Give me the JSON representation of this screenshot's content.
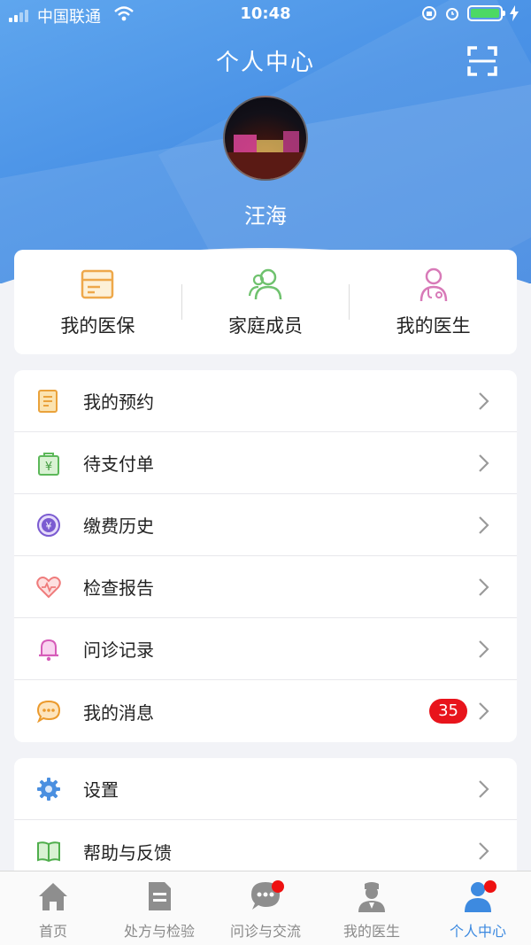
{
  "status_bar": {
    "carrier": "中国联通",
    "time": "10:48"
  },
  "header": {
    "title": "个人中心",
    "user_name": "汪海"
  },
  "quick_actions": [
    {
      "label": "我的医保",
      "icon": "card-icon"
    },
    {
      "label": "家庭成员",
      "icon": "family-icon"
    },
    {
      "label": "我的医生",
      "icon": "doctor-icon"
    }
  ],
  "menu_primary": [
    {
      "label": "我的预约",
      "icon": "appointment-icon"
    },
    {
      "label": "待支付单",
      "icon": "payment-bag-icon"
    },
    {
      "label": "缴费历史",
      "icon": "yuan-coin-icon"
    },
    {
      "label": "检查报告",
      "icon": "heart-report-icon"
    },
    {
      "label": "问诊记录",
      "icon": "bell-icon"
    },
    {
      "label": "我的消息",
      "icon": "message-icon",
      "badge": "35"
    }
  ],
  "menu_secondary": [
    {
      "label": "设置",
      "icon": "gear-icon"
    },
    {
      "label": "帮助与反馈",
      "icon": "book-icon"
    }
  ],
  "tab_bar": [
    {
      "label": "首页",
      "icon": "home-icon"
    },
    {
      "label": "处方与检验",
      "icon": "prescription-icon"
    },
    {
      "label": "问诊与交流",
      "icon": "chat-icon",
      "dot": true
    },
    {
      "label": "我的医生",
      "icon": "doctor-icon"
    },
    {
      "label": "个人中心",
      "icon": "person-icon",
      "dot": true,
      "active": true
    }
  ],
  "colors": {
    "accent": "#3d8ae0",
    "badge": "#e8141c",
    "header": "#4a92e6"
  }
}
